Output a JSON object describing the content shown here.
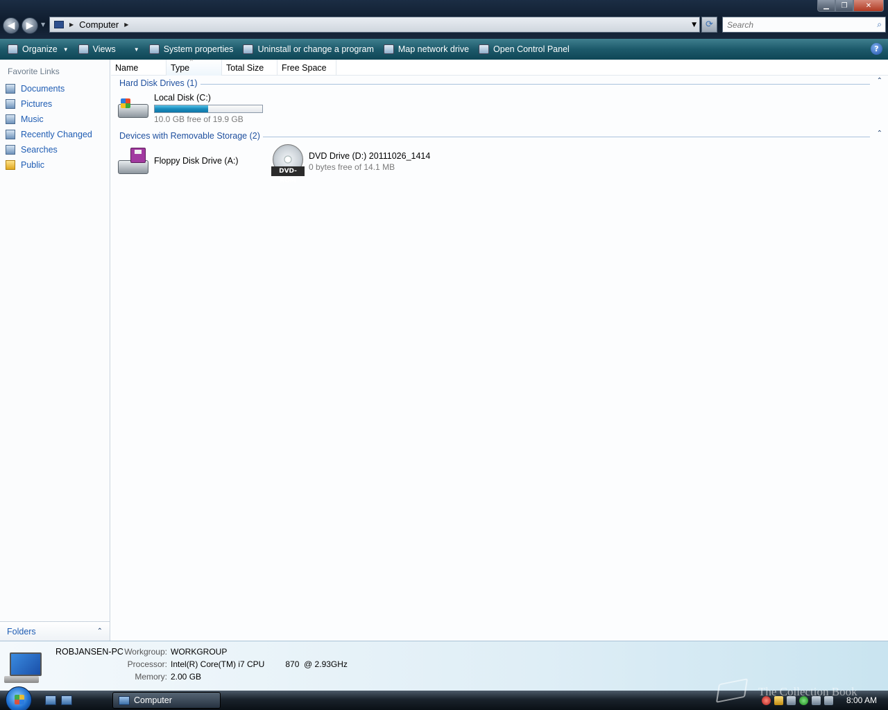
{
  "window": {
    "buttons": {
      "minimize": "▁",
      "restore": "❐",
      "close": "✕"
    }
  },
  "navigation": {
    "back_glyph": "◀",
    "forward_glyph": "▶",
    "address": {
      "crumbs": [
        "Computer"
      ],
      "separator": "▶"
    },
    "refresh_glyph": "⟳",
    "search_placeholder": "Search",
    "search_glyph": "⌕"
  },
  "toolbar": {
    "items": [
      {
        "label": "Organize",
        "has_dropdown": true,
        "icon": "organize-icon"
      },
      {
        "label": "Views",
        "has_dropdown": true,
        "icon": "views-icon"
      },
      {
        "label": "System properties",
        "icon": "system-properties-icon"
      },
      {
        "label": "Uninstall or change a program",
        "icon": "uninstall-icon"
      },
      {
        "label": "Map network drive",
        "icon": "network-drive-icon"
      },
      {
        "label": "Open Control Panel",
        "icon": "control-panel-icon"
      }
    ],
    "dropdown_glyph": "▼",
    "help_glyph": "?"
  },
  "sidebar": {
    "title": "Favorite Links",
    "items": [
      {
        "label": "Documents",
        "icon": "documents-icon"
      },
      {
        "label": "Pictures",
        "icon": "pictures-icon"
      },
      {
        "label": "Music",
        "icon": "music-icon"
      },
      {
        "label": "Recently Changed",
        "icon": "recently-changed-icon"
      },
      {
        "label": "Searches",
        "icon": "searches-icon"
      },
      {
        "label": "Public",
        "icon": "public-folder-icon"
      }
    ],
    "folders_label": "Folders",
    "folders_chevron": "⌃"
  },
  "columns": [
    {
      "label": "Name",
      "sorted": false
    },
    {
      "label": "Type",
      "sorted": true
    },
    {
      "label": "Total Size",
      "sorted": false
    },
    {
      "label": "Free Space",
      "sorted": false
    }
  ],
  "sort_glyph": "^",
  "groups": {
    "hard_disk": {
      "title": "Hard Disk Drives (1)",
      "collapse_glyph": "⌃",
      "drives": [
        {
          "name": "Local Disk (C:)",
          "detail": "10.0 GB free of 19.9 GB",
          "used_fraction": 0.497,
          "icon": "hard-drive-icon"
        }
      ]
    },
    "removable": {
      "title": "Devices with Removable Storage (2)",
      "collapse_glyph": "⌃",
      "drives": [
        {
          "name": "Floppy Disk Drive (A:)",
          "detail": "",
          "icon": "floppy-drive-icon"
        },
        {
          "name": "DVD Drive (D:) 20111026_1414",
          "detail": "0 bytes free of 14.1 MB",
          "icon": "dvd-drive-icon",
          "badge": "DVD-ROM"
        }
      ]
    }
  },
  "details": {
    "computer_name": "ROBJANSEN-PC",
    "workgroup_label": "Workgroup:",
    "workgroup": "WORKGROUP",
    "processor_label": "Processor:",
    "processor": "Intel(R) Core(TM) i7 CPU         870  @ 2.93GHz",
    "memory_label": "Memory:",
    "memory": "2.00 GB"
  },
  "taskbar": {
    "task_label": "Computer",
    "clock": "8:00 AM"
  },
  "watermark": {
    "text": "The Collection Book"
  }
}
